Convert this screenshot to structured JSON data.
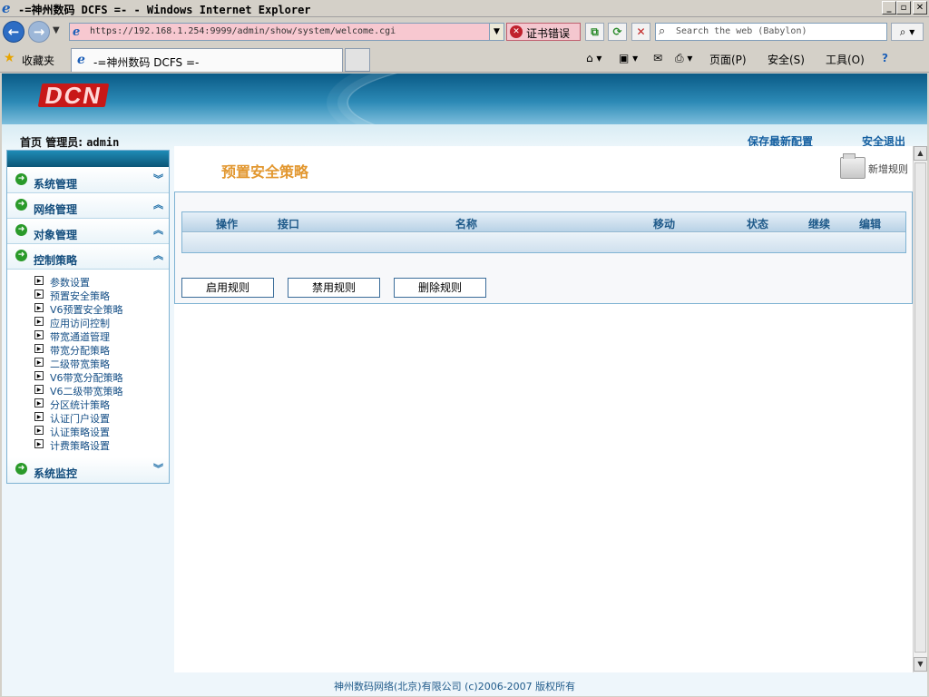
{
  "window": {
    "title": "-=神州数码 DCFS =- - Windows Internet Explorer",
    "app_icon": "ie-icon",
    "buttons": {
      "minimize": "_",
      "maximize": "▫",
      "close": "✕"
    }
  },
  "address_bar": {
    "url": "https://192.168.1.254:9999/admin/show/system/welcome.cgi",
    "cert_error_label": "证书错误",
    "search_placeholder": "Search the web (Babylon)",
    "refresh_glyph": "⟳",
    "stop_glyph": "✕",
    "compat_glyph": "⧉"
  },
  "favorites_bar": {
    "favorites_label": "收藏夹",
    "tab_title": "-=神州数码 DCFS =-",
    "commands": {
      "page": "页面(P)",
      "safety": "安全(S)",
      "tools": "工具(O)",
      "help": "?"
    }
  },
  "header": {
    "logo_text": "DCN",
    "breadcrumb_home": "首页",
    "admin_label": "管理员:",
    "admin_name": "admin",
    "save_config": "保存最新配置",
    "logout": "安全退出"
  },
  "sidebar": {
    "items": [
      {
        "label": "系统管理",
        "chevron": "︾"
      },
      {
        "label": "网络管理",
        "chevron": "︽"
      },
      {
        "label": "对象管理",
        "chevron": "︽"
      },
      {
        "label": "控制策略",
        "chevron": "︽"
      }
    ],
    "submenu": [
      "参数设置",
      "预置安全策略",
      "V6预置安全策略",
      "应用访问控制",
      "带宽通道管理",
      "带宽分配策略",
      "二级带宽策略",
      "V6带宽分配策略",
      "V6二级带宽策略",
      "分区统计策略",
      "认证门户设置",
      "认证策略设置",
      "计费策略设置"
    ],
    "last_item": {
      "label": "系统监控",
      "chevron": "︾"
    }
  },
  "main": {
    "page_title": "预置安全策略",
    "add_rule": "新增规则",
    "table_columns": [
      "操作",
      "接口",
      "名称",
      "移动",
      "状态",
      "继续",
      "编辑"
    ],
    "buttons": {
      "enable": "启用规则",
      "disable": "禁用规则",
      "delete": "删除规则"
    }
  },
  "footer": {
    "copyright": "神州数码网络(北京)有限公司 (c)2006-2007 版权所有"
  }
}
